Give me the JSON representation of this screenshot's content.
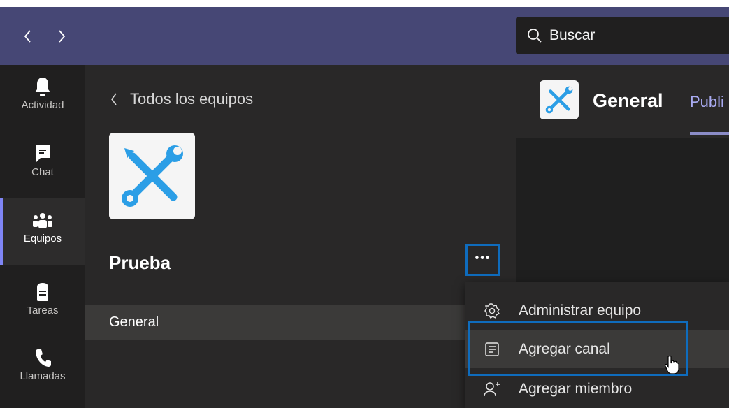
{
  "topbar": {
    "back_icon": "chevron-left-icon",
    "forward_icon": "chevron-right-icon",
    "search": {
      "placeholder": "Buscar",
      "icon": "search-icon"
    }
  },
  "rail": {
    "items": [
      {
        "label": "Actividad",
        "icon": "bell-icon"
      },
      {
        "label": "Chat",
        "icon": "chat-icon"
      },
      {
        "label": "Equipos",
        "icon": "teams-icon",
        "active": true
      },
      {
        "label": "Tareas",
        "icon": "tasks-icon"
      },
      {
        "label": "Llamadas",
        "icon": "phone-icon"
      }
    ]
  },
  "panel": {
    "back_label": "Todos los equipos",
    "team_name": "Prueba",
    "team_logo_icon": "tools-icon",
    "more_icon": "more-options-icon",
    "channels": [
      {
        "label": "General"
      }
    ]
  },
  "main": {
    "channel_title": "General",
    "tabs": [
      {
        "label": "Publi"
      }
    ]
  },
  "context_menu": {
    "items": [
      {
        "label": "Administrar equipo",
        "icon": "gear-icon"
      },
      {
        "label": "Agregar canal",
        "icon": "add-channel-icon",
        "highlighted": true
      },
      {
        "label": "Agregar miembro",
        "icon": "add-person-icon"
      }
    ]
  },
  "colors": {
    "topbar": "#464775",
    "rail": "#201f1f",
    "panel": "#292828",
    "accent": "#7f85f5",
    "focus": "#0f6cbd",
    "logo_blue": "#2b9ee6"
  }
}
